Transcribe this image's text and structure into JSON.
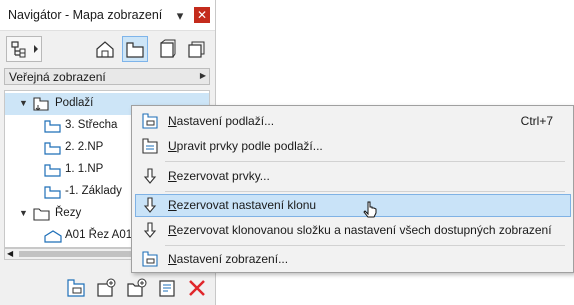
{
  "window": {
    "title": "Navigátor - Mapa zobrazení"
  },
  "colors": {
    "selection": "#cde5f7",
    "menu_highlight": "#c9e3f8",
    "close": "#c42b1c",
    "delete_icon": "#e0262b",
    "icon_blue": "#1e6fb8"
  },
  "mapbar": {
    "label": "Veřejná zobrazení"
  },
  "tree": {
    "root": {
      "label": "Podlaží"
    },
    "stories": [
      {
        "label": "3. Střecha"
      },
      {
        "label": "2. 2.NP"
      },
      {
        "label": "1. 1.NP"
      },
      {
        "label": "-1. Základy"
      }
    ],
    "sections": {
      "label": "Řezy"
    },
    "section_items": [
      {
        "label": "A01 Řez A01"
      }
    ]
  },
  "menu": {
    "items": [
      {
        "first": "N",
        "rest": "astavení podlaží...",
        "shortcut": "Ctrl+7",
        "icon": "story-settings-icon"
      },
      {
        "first": "U",
        "rest": "pravit prvky podle podlaží...",
        "shortcut": "",
        "icon": "edit-by-story-icon"
      },
      {
        "first": "R",
        "rest": "ezervovat prvky...",
        "shortcut": "",
        "icon": "reserve-elements-icon"
      },
      {
        "first": "R",
        "rest": "ezervovat nastavení klonu",
        "shortcut": "",
        "icon": "reserve-clone-icon"
      },
      {
        "first": "R",
        "rest": "ezervovat klonovanou složku a nastavení všech dostupných zobrazení",
        "shortcut": "",
        "icon": "reserve-folder-icon"
      },
      {
        "first": "N",
        "rest": "astavení zobrazení...",
        "shortcut": "",
        "icon": "view-settings-icon"
      }
    ]
  }
}
